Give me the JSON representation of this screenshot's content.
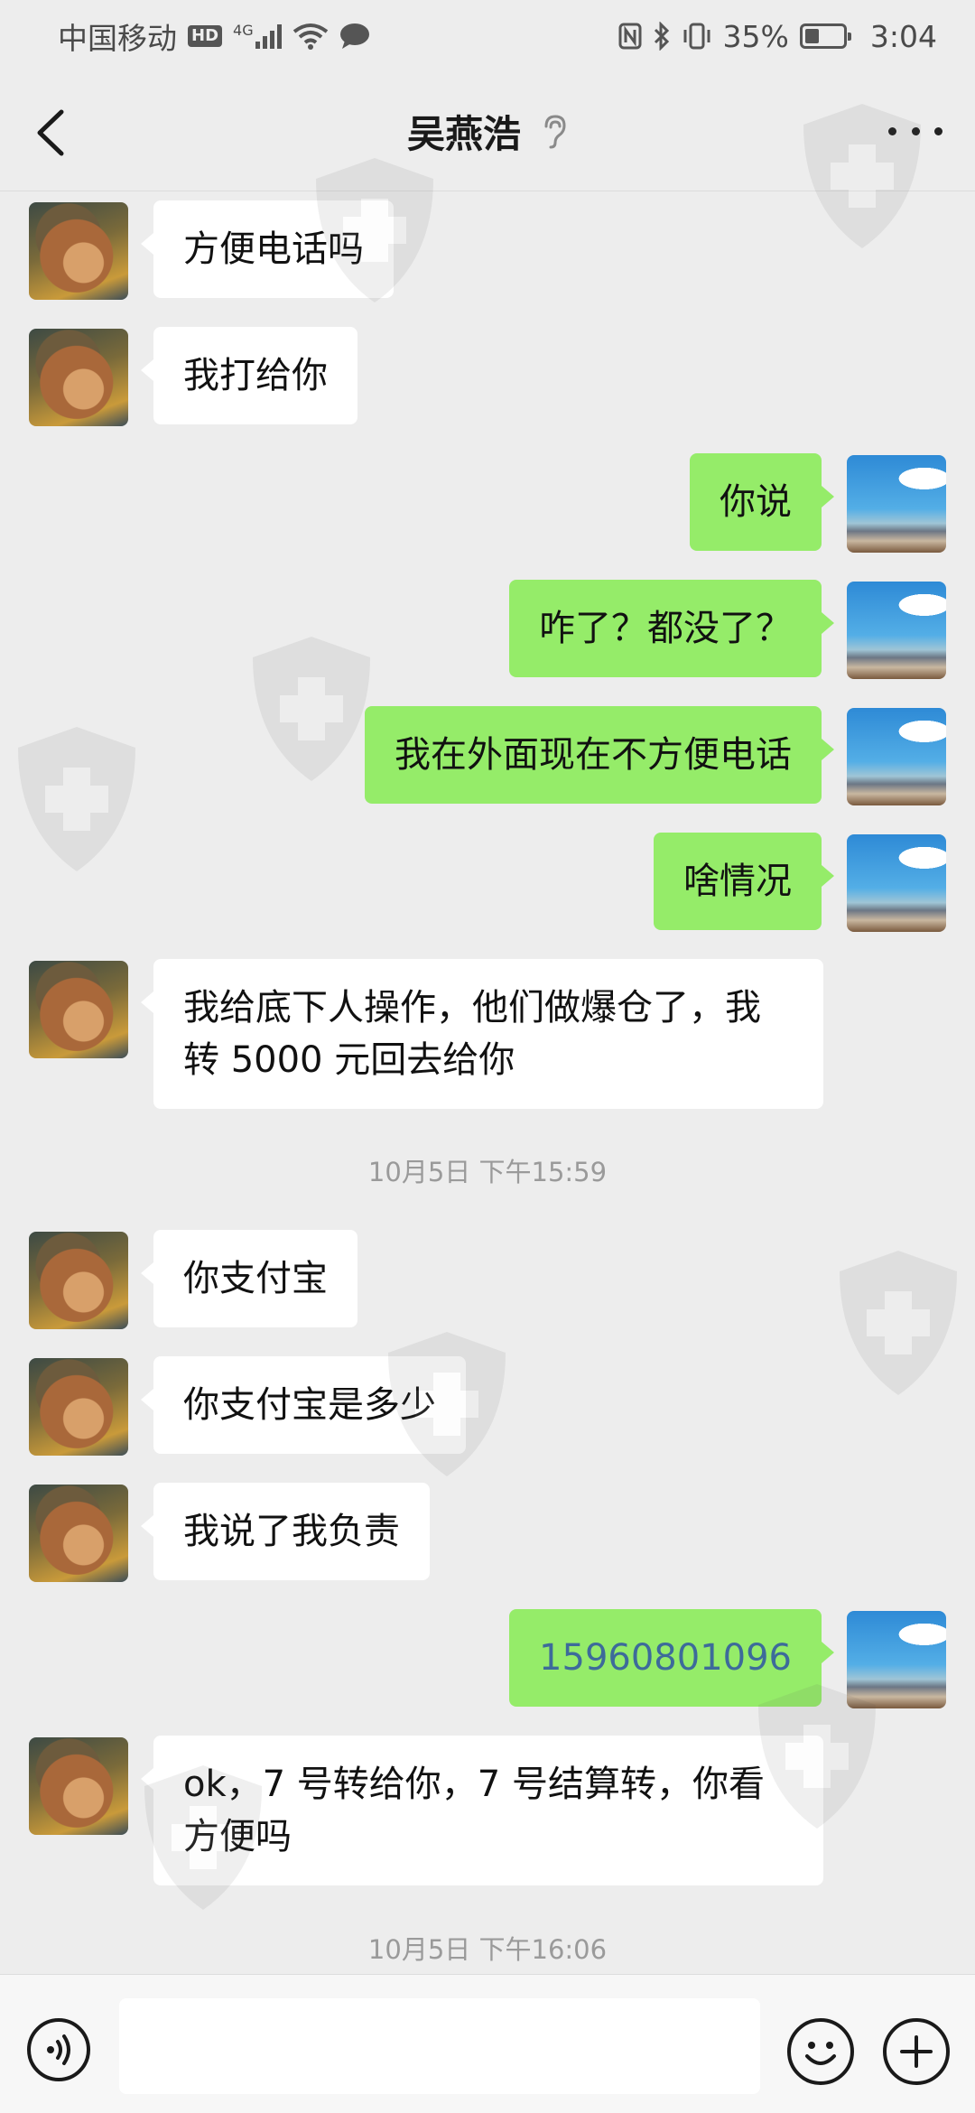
{
  "status_bar": {
    "carrier": "中国移动",
    "hd_badge": "HD",
    "network": "4G",
    "battery": "35%",
    "time": "3:04"
  },
  "header": {
    "title": "吴燕浩"
  },
  "icons": {
    "back": "back-icon",
    "ear": "ear-icon",
    "more": "more-icon",
    "voice": "voice-icon",
    "emoji": "emoji-icon",
    "plus": "plus-icon",
    "watermark": "shield-cross-icon"
  },
  "messages": [
    {
      "side": "in",
      "text": "方便电话吗"
    },
    {
      "side": "in",
      "text": "我打给你"
    },
    {
      "side": "out",
      "text": "你说"
    },
    {
      "side": "out",
      "text": "咋了？都没了？"
    },
    {
      "side": "out",
      "text": "我在外面现在不方便电话"
    },
    {
      "side": "out",
      "text": "啥情况"
    },
    {
      "side": "in",
      "text": "我给底下人操作，他们做爆仓了，我转 5000 元回去给你"
    },
    {
      "side": "in",
      "text": "你支付宝"
    },
    {
      "side": "in",
      "text": "你支付宝是多少"
    },
    {
      "side": "in",
      "text": "我说了我负责"
    },
    {
      "side": "out",
      "text": "15960801096"
    },
    {
      "side": "in",
      "text": "ok，7 号转给你，7 号结算转，你看方便吗"
    }
  ],
  "timestamps": [
    "10月5日 下午15:59",
    "10月5日 下午16:06"
  ],
  "colors": {
    "background": "#ededed",
    "outgoing_bubble": "#95ec69",
    "incoming_bubble": "#ffffff",
    "phone_link": "#3d6b9a"
  }
}
